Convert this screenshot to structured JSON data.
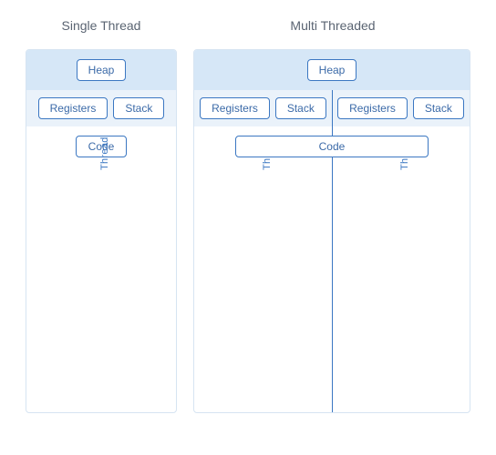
{
  "titles": {
    "single": "Single Thread",
    "multi": "Multi Threaded"
  },
  "labels": {
    "heap": "Heap",
    "registers": "Registers",
    "stack": "Stack",
    "code": "Code",
    "thread": "Thread"
  },
  "diagram": {
    "single": {
      "thread_count": 1
    },
    "multi": {
      "thread_count": 2
    }
  },
  "colors": {
    "accent": "#3b77c2",
    "band_heap": "#d6e7f7",
    "band_reg": "#eaf2fa",
    "border": "#d6e4f2"
  }
}
